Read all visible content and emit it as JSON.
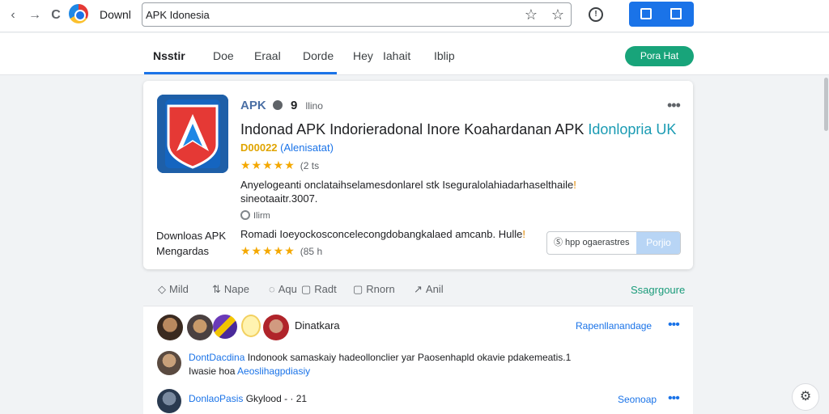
{
  "browser": {
    "back_icon": "‹",
    "forward_icon": "→",
    "reload_icon": "C",
    "site_name": "Downl",
    "address": "APK Idonesia",
    "bookmark_icon": "☆",
    "star_icon": "☆",
    "extension_icon": "!"
  },
  "tabs": [
    {
      "label": "Nsstir"
    },
    {
      "label": "Doe"
    },
    {
      "label": "Eraal"
    },
    {
      "label": "Dorde"
    },
    {
      "label": "Hey"
    },
    {
      "label": "Iahait"
    },
    {
      "label": "Iblip"
    }
  ],
  "header_button": "Pora Hat",
  "app": {
    "brand": "APK",
    "verified": "9",
    "brand_tag": "llino",
    "title_main": "Indonad APK Indorieradonal Inore Koahardanan APK ",
    "title_highlight": "Idonlopria UK",
    "dev_code": "D00022",
    "dev_name": "(Alenisatat)",
    "rating_stars": "★★★★★",
    "rating_count": "(2 ts",
    "description": "Anyelogeanti onclataihselamesdonlarel stk Iseguralolahiadarhaselthaile",
    "description_mark": "!",
    "description_line2": "sineotaaitr.3007.",
    "meta": "Ilirm",
    "downloads_label_1": "Downloas APK",
    "downloads_label_2": "Mengardas",
    "install_text": "Romadi Ioeyockosconcelecongdobangkalaed amcanb. Hulle",
    "install_mark": "!",
    "rating2_stars": "★★★★★",
    "rating2_count": "(85 h",
    "more": "•••",
    "seg_left": "Ⓢ hpp ogaerastres",
    "seg_right": "Porjio"
  },
  "actions": [
    {
      "icon": "◇",
      "label": "Mild"
    },
    {
      "icon": "⇅",
      "label": "Nape"
    },
    {
      "icon": "◌",
      "label": "Aqu"
    },
    {
      "icon": "▢",
      "label": "Radt"
    },
    {
      "icon": "▢",
      "label": "Rnorn"
    },
    {
      "icon": "↗",
      "label": "Anil"
    }
  ],
  "actions_right": "Ssagrgoure",
  "comments": {
    "row1_name": "Dinatkara",
    "row1_link": "Rapenllanandage",
    "dots": "•••",
    "comment_author": "DontDacdina",
    "comment_text": "Indonook samaskaiy hadeollonclier yar Paosenhapld okavie pdakemeatis.1",
    "comment_line2_a": "Iwasie hoa",
    "comment_line2_b": "Aeoslihagpdiasiy",
    "row3_name": "DonlaoPasis",
    "row3_meta": "Gkylood - · 21",
    "row3_link": "Seonoap"
  },
  "colors": {
    "accent": "#1a73e8",
    "green": "#18a47a",
    "star": "#f4a800"
  }
}
